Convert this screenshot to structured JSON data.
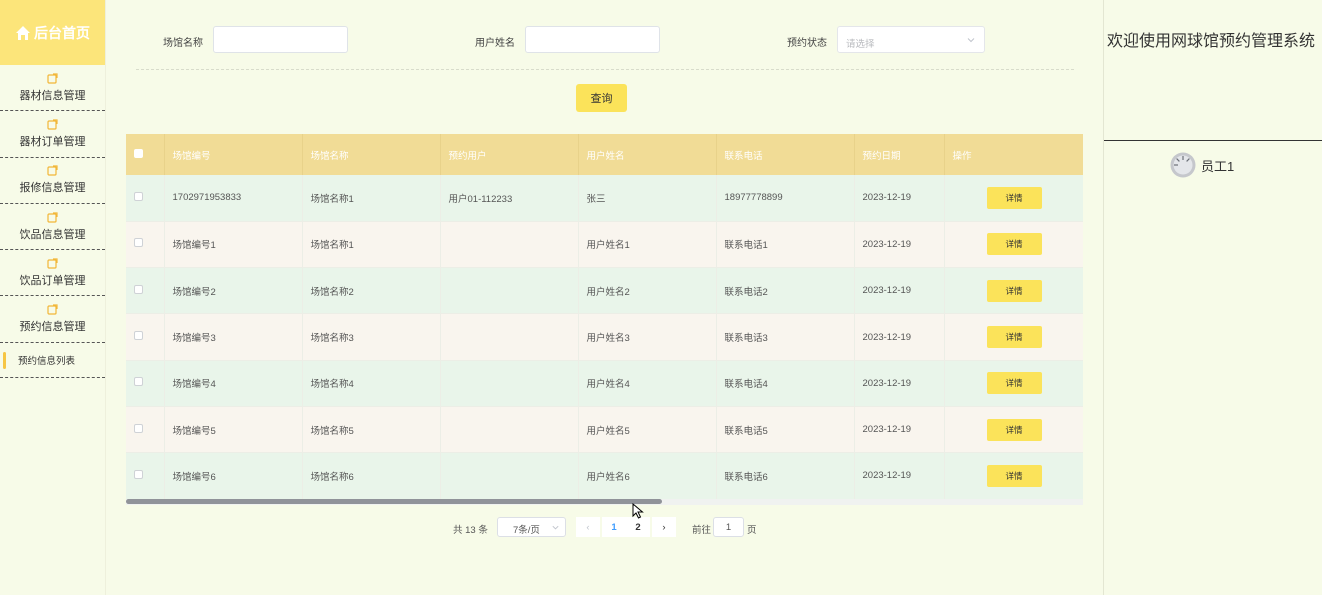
{
  "sidebar": {
    "home_label": "后台首页",
    "items": [
      {
        "label": "器材信息管理"
      },
      {
        "label": "器材订单管理"
      },
      {
        "label": "报修信息管理"
      },
      {
        "label": "饮品信息管理"
      },
      {
        "label": "饮品订单管理"
      },
      {
        "label": "预约信息管理"
      }
    ],
    "sub_item": "预约信息列表"
  },
  "search": {
    "venue_label": "场馆名称",
    "venue_value": "",
    "user_label": "用户姓名",
    "user_value": "",
    "status_label": "预约状态",
    "status_placeholder": "请选择",
    "query_label": "查询"
  },
  "table": {
    "headers": [
      "场馆编号",
      "场馆名称",
      "预约用户",
      "用户姓名",
      "联系电话",
      "预约日期",
      "操作"
    ],
    "detail_label": "详情",
    "rows": [
      [
        "1702971953833",
        "场馆名称1",
        "用户01-112233",
        "张三",
        "18977778899",
        "2023-12-19"
      ],
      [
        "场馆编号1",
        "场馆名称1",
        "",
        "用户姓名1",
        "联系电话1",
        "2023-12-19"
      ],
      [
        "场馆编号2",
        "场馆名称2",
        "",
        "用户姓名2",
        "联系电话2",
        "2023-12-19"
      ],
      [
        "场馆编号3",
        "场馆名称3",
        "",
        "用户姓名3",
        "联系电话3",
        "2023-12-19"
      ],
      [
        "场馆编号4",
        "场馆名称4",
        "",
        "用户姓名4",
        "联系电话4",
        "2023-12-19"
      ],
      [
        "场馆编号5",
        "场馆名称5",
        "",
        "用户姓名5",
        "联系电话5",
        "2023-12-19"
      ],
      [
        "场馆编号6",
        "场馆名称6",
        "",
        "用户姓名6",
        "联系电话6",
        "2023-12-19"
      ]
    ]
  },
  "pager": {
    "total": "共 13 条",
    "page_size": "7条/页",
    "prev": "‹",
    "pages": [
      "1",
      "2"
    ],
    "next": "›",
    "goto_label": "前往",
    "goto_value": "1",
    "page_suffix": "页",
    "scroll_fraction": 0.56
  },
  "right_panel": {
    "welcome": "欢迎使用网球馆预约管理系统",
    "user_name": "员工1"
  },
  "colors": {
    "accent": "#fbe35a",
    "header_bg": "#f1dc96",
    "sidebar_home": "#fce57a",
    "page_bg": "#f7fbe8",
    "row_odd": "#e9f5ea",
    "row_even": "#f9f5ee",
    "link_blue": "#409eff"
  },
  "icons": {
    "home": "home-icon",
    "menu": "folder-icon",
    "chevron": "chevron-down-icon",
    "avatar": "avatar-icon"
  }
}
